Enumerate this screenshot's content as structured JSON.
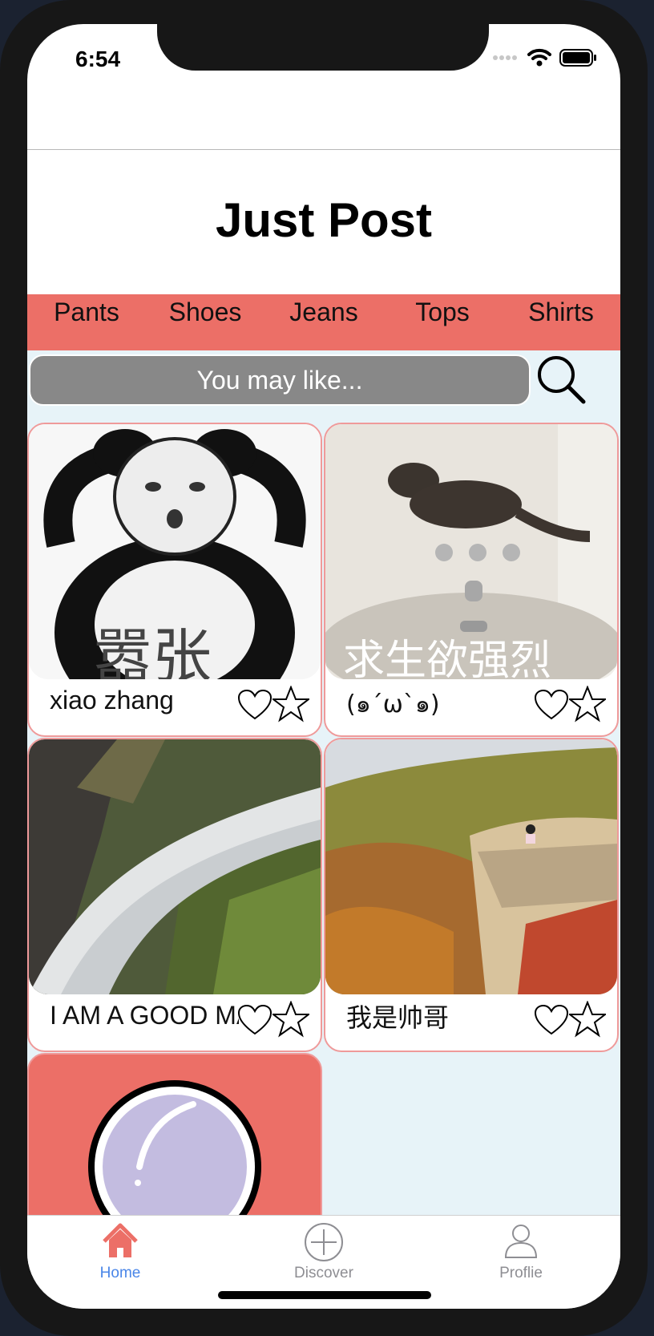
{
  "status": {
    "time": "6:54"
  },
  "header": {
    "title": "Just Post"
  },
  "categories": [
    "Pants",
    "Shoes",
    "Jeans",
    "Tops",
    "Shirts"
  ],
  "search": {
    "placeholder": "You may like..."
  },
  "posts": [
    {
      "label": "xiao zhang",
      "image_text": "嚣张"
    },
    {
      "label": "(๑ˊωˋ๑)",
      "image_text": "求生欲强烈"
    },
    {
      "label": "I AM A GOOD MAN"
    },
    {
      "label": "我是帅哥"
    }
  ],
  "tabs": [
    {
      "label": "Home",
      "icon": "house-icon",
      "active": true
    },
    {
      "label": "Discover",
      "icon": "plus-circle-icon",
      "active": false
    },
    {
      "label": "Proflie",
      "icon": "person-icon",
      "active": false
    }
  ],
  "colors": {
    "accent": "#ec6f67",
    "active_tab": "#4a86e8",
    "inactive_tab": "#8e8e93",
    "content_bg": "#e7f3f8",
    "search_bg": "#888888",
    "card_border": "#ef9a9a"
  }
}
